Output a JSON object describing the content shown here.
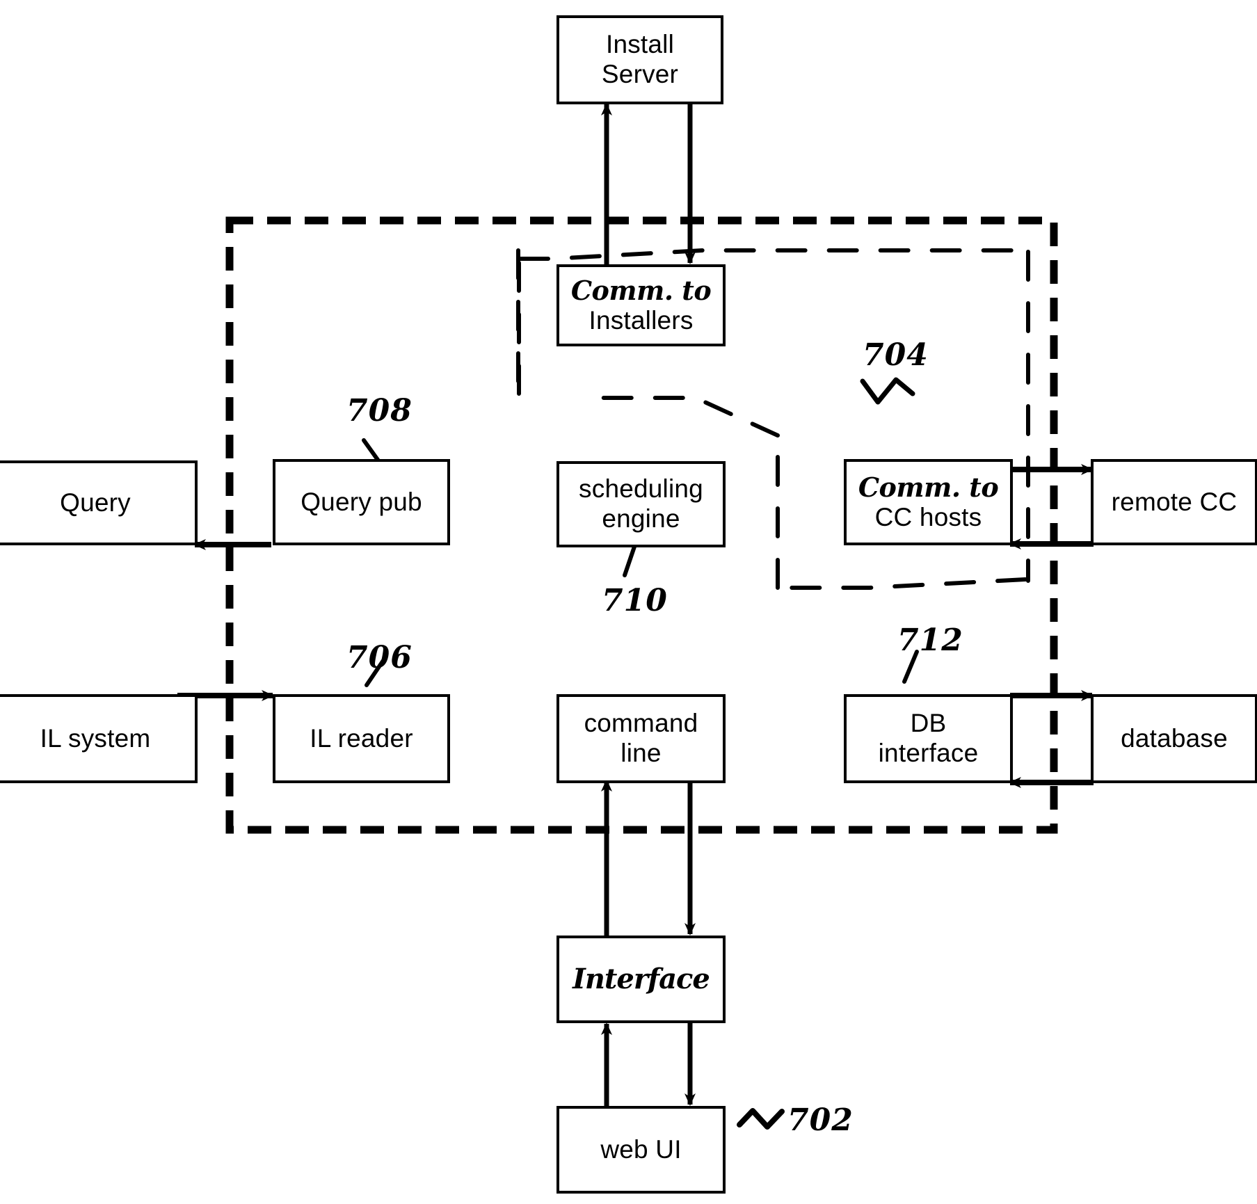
{
  "diagram": {
    "title": "System architecture block diagram",
    "stroke_color": "#000000",
    "background_color": "#ffffff",
    "boundary": {
      "label": "dashed system boundary",
      "style": "thick dashed rectangle"
    },
    "inner_dashed_region": {
      "label": "thin dashed sub-region",
      "style": "thin dashed irregular outline"
    }
  },
  "boxes": {
    "install_server": {
      "line1": "Install",
      "line2": "Server",
      "style": "printed"
    },
    "comm_to_installers": {
      "line1": "Comm. to",
      "line2": "Installers",
      "style": "mixed-handwritten"
    },
    "query": {
      "line1": "Query",
      "style": "printed"
    },
    "query_pub": {
      "line1": "Query pub",
      "style": "printed"
    },
    "scheduling_engine": {
      "line1": "scheduling",
      "line2": "engine",
      "style": "printed"
    },
    "comm_to_cc_hosts": {
      "line1": "Comm. to",
      "line2": "CC hosts",
      "style": "mixed-handwritten"
    },
    "remote_cc": {
      "line1": "remote CC",
      "style": "printed"
    },
    "il_system": {
      "line1": "IL system",
      "style": "printed"
    },
    "il_reader": {
      "line1": "IL reader",
      "style": "printed"
    },
    "command_line": {
      "line1": "command",
      "line2": "line",
      "style": "printed"
    },
    "db_interface": {
      "line1": "DB",
      "line2": "interface",
      "style": "printed"
    },
    "database": {
      "line1": "database",
      "style": "printed"
    },
    "interface": {
      "line1": "Interface",
      "style": "cursive-handwritten"
    },
    "web_ui": {
      "line1": "web UI",
      "style": "printed"
    }
  },
  "reference_numerals": {
    "n702": "702",
    "n702_prefix": "~",
    "n704": "704",
    "n706": "706",
    "n708": "708",
    "n710": "710",
    "n712": "712"
  },
  "connections": [
    {
      "from": "comm_to_installers",
      "to": "install_server",
      "direction": "up"
    },
    {
      "from": "install_server",
      "to": "comm_to_installers",
      "direction": "down"
    },
    {
      "from": "query_pub",
      "to": "query",
      "direction": "left"
    },
    {
      "from": "il_system",
      "to": "il_reader",
      "direction": "right"
    },
    {
      "from": "comm_to_cc_hosts",
      "to": "remote_cc",
      "direction": "right"
    },
    {
      "from": "remote_cc",
      "to": "comm_to_cc_hosts",
      "direction": "left"
    },
    {
      "from": "db_interface",
      "to": "database",
      "direction": "right"
    },
    {
      "from": "database",
      "to": "db_interface",
      "direction": "left"
    },
    {
      "from": "interface",
      "to": "command_line",
      "direction": "up"
    },
    {
      "from": "command_line",
      "to": "interface",
      "direction": "down"
    },
    {
      "from": "web_ui",
      "to": "interface",
      "direction": "up"
    },
    {
      "from": "interface",
      "to": "web_ui",
      "direction": "down"
    }
  ]
}
